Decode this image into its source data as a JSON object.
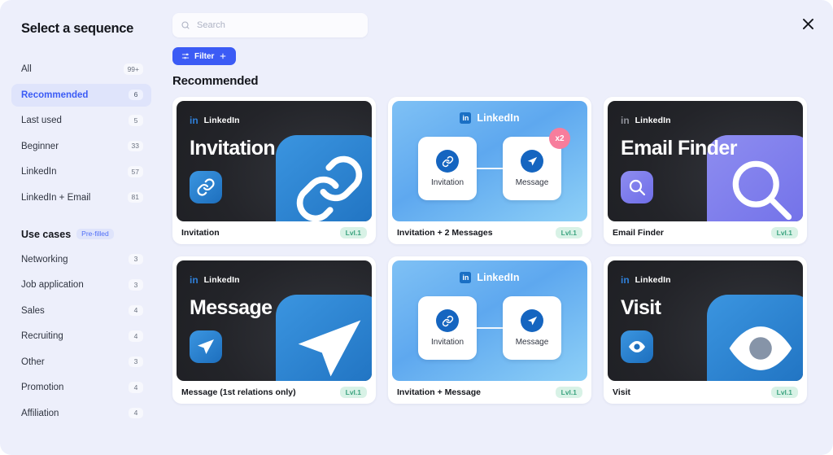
{
  "modal": {
    "title": "Select a sequence",
    "close_label": "close-icon"
  },
  "sidebar": {
    "filters": [
      {
        "label": "All",
        "count": "99+",
        "active": false
      },
      {
        "label": "Recommended",
        "count": "6",
        "active": true
      },
      {
        "label": "Last used",
        "count": "5",
        "active": false
      },
      {
        "label": "Beginner",
        "count": "33",
        "active": false
      },
      {
        "label": "LinkedIn",
        "count": "57",
        "active": false
      },
      {
        "label": "LinkedIn + Email",
        "count": "81",
        "active": false
      }
    ],
    "use_cases_heading": "Use cases",
    "use_cases_badge": "Pre-filled",
    "use_cases": [
      {
        "label": "Networking",
        "count": "3"
      },
      {
        "label": "Job application",
        "count": "3"
      },
      {
        "label": "Sales",
        "count": "4"
      },
      {
        "label": "Recruiting",
        "count": "4"
      },
      {
        "label": "Other",
        "count": "3"
      },
      {
        "label": "Promotion",
        "count": "4"
      },
      {
        "label": "Affiliation",
        "count": "4"
      }
    ]
  },
  "search": {
    "placeholder": "Search",
    "value": ""
  },
  "toolbar": {
    "filter_label": "Filter"
  },
  "main": {
    "section_title": "Recommended"
  },
  "cards": [
    {
      "name": "Invitation",
      "level": "Lvl.1",
      "style": "dark",
      "brand": "LinkedIn",
      "hero_title": "Invitation",
      "icon": "link-icon",
      "accent": "blue"
    },
    {
      "name": "Invitation + 2 Messages",
      "level": "Lvl.1",
      "style": "flow",
      "brand": "LinkedIn",
      "nodes": [
        {
          "label": "Invitation",
          "icon": "link-icon"
        },
        {
          "label": "Message",
          "icon": "send-icon",
          "badge": "x2"
        }
      ]
    },
    {
      "name": "Email Finder",
      "level": "Lvl.1",
      "style": "dark",
      "brand": "LinkedIn",
      "hero_title": "Email Finder",
      "icon": "magnifier-icon",
      "accent": "purple"
    },
    {
      "name": "Message (1st relations only)",
      "level": "Lvl.1",
      "style": "dark",
      "brand": "LinkedIn",
      "hero_title": "Message",
      "icon": "send-icon",
      "accent": "blue"
    },
    {
      "name": "Invitation + Message",
      "level": "Lvl.1",
      "style": "flow",
      "brand": "LinkedIn",
      "nodes": [
        {
          "label": "Invitation",
          "icon": "link-icon"
        },
        {
          "label": "Message",
          "icon": "send-icon"
        }
      ]
    },
    {
      "name": "Visit",
      "level": "Lvl.1",
      "style": "dark",
      "brand": "LinkedIn",
      "hero_title": "Visit",
      "icon": "eye-icon",
      "accent": "blue"
    }
  ],
  "colors": {
    "accent": "#3b5bf5",
    "page_bg": "#edeffb",
    "level_badge": "#d8f2e6",
    "x_badge": "#f77d9c"
  }
}
